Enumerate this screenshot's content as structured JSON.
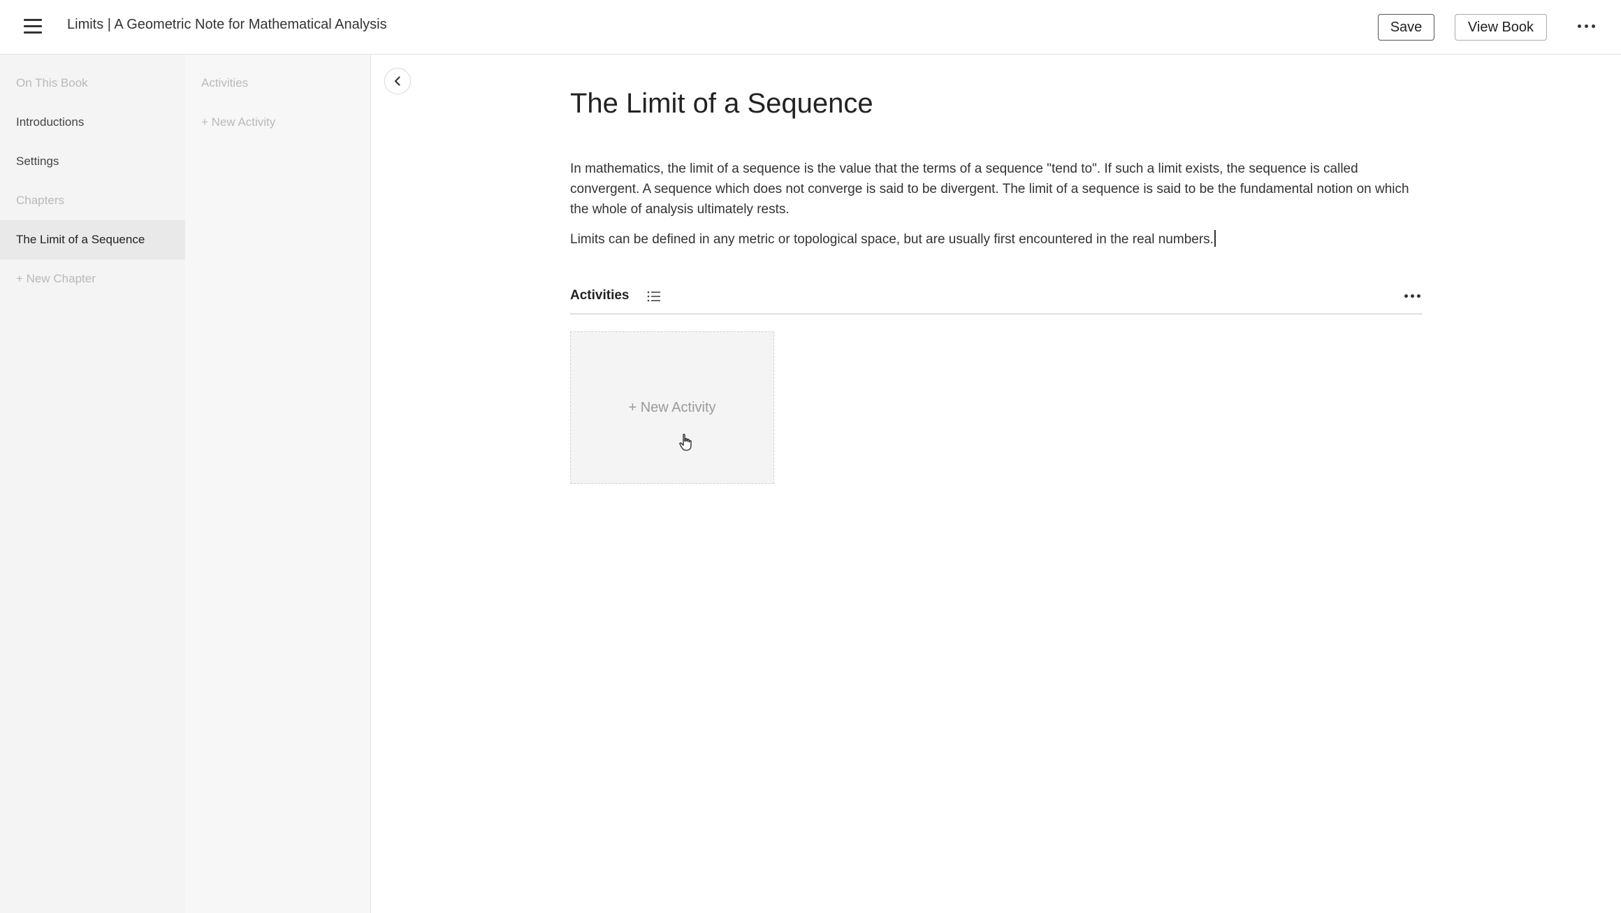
{
  "header": {
    "title": "Limits | A Geometric Note for Mathematical Analysis",
    "save_label": "Save",
    "view_book_label": "View Book"
  },
  "sidebar": {
    "on_this_book_label": "On This Book",
    "introductions_label": "Introductions",
    "settings_label": "Settings",
    "chapters_label": "Chapters",
    "active_chapter_label": "The Limit of a Sequence",
    "new_chapter_label": "+ New Chapter"
  },
  "subsidebar": {
    "activities_label": "Activities",
    "new_activity_label": "+ New Activity"
  },
  "main": {
    "title": "The Limit of a Sequence",
    "paragraphs": [
      "In mathematics, the limit of a sequence is the value that the terms of a sequence \"tend to\". If such a limit exists, the sequence is called convergent. A sequence which does not converge is said to be divergent. The limit of a sequence is said to be the fundamental notion on which the whole of analysis ultimately rests.",
      "Limits can be defined in any metric or topological space, but are usually first encountered in the real numbers."
    ],
    "activities": {
      "title": "Activities",
      "new_activity_label": "+ New Activity"
    }
  },
  "icons": {
    "menu": "hamburger-menu-icon",
    "more": "more-horizontal-icon",
    "collapse": "chevron-left-icon",
    "list": "list-icon",
    "cursor": "hand-pointer-icon"
  },
  "colors": {
    "sidebar_bg": "#f4f4f4",
    "subsidebar_bg": "#f7f7f7",
    "active_item_bg": "#e9e9e9",
    "muted_text": "#b9b9b9",
    "text": "#222222"
  }
}
